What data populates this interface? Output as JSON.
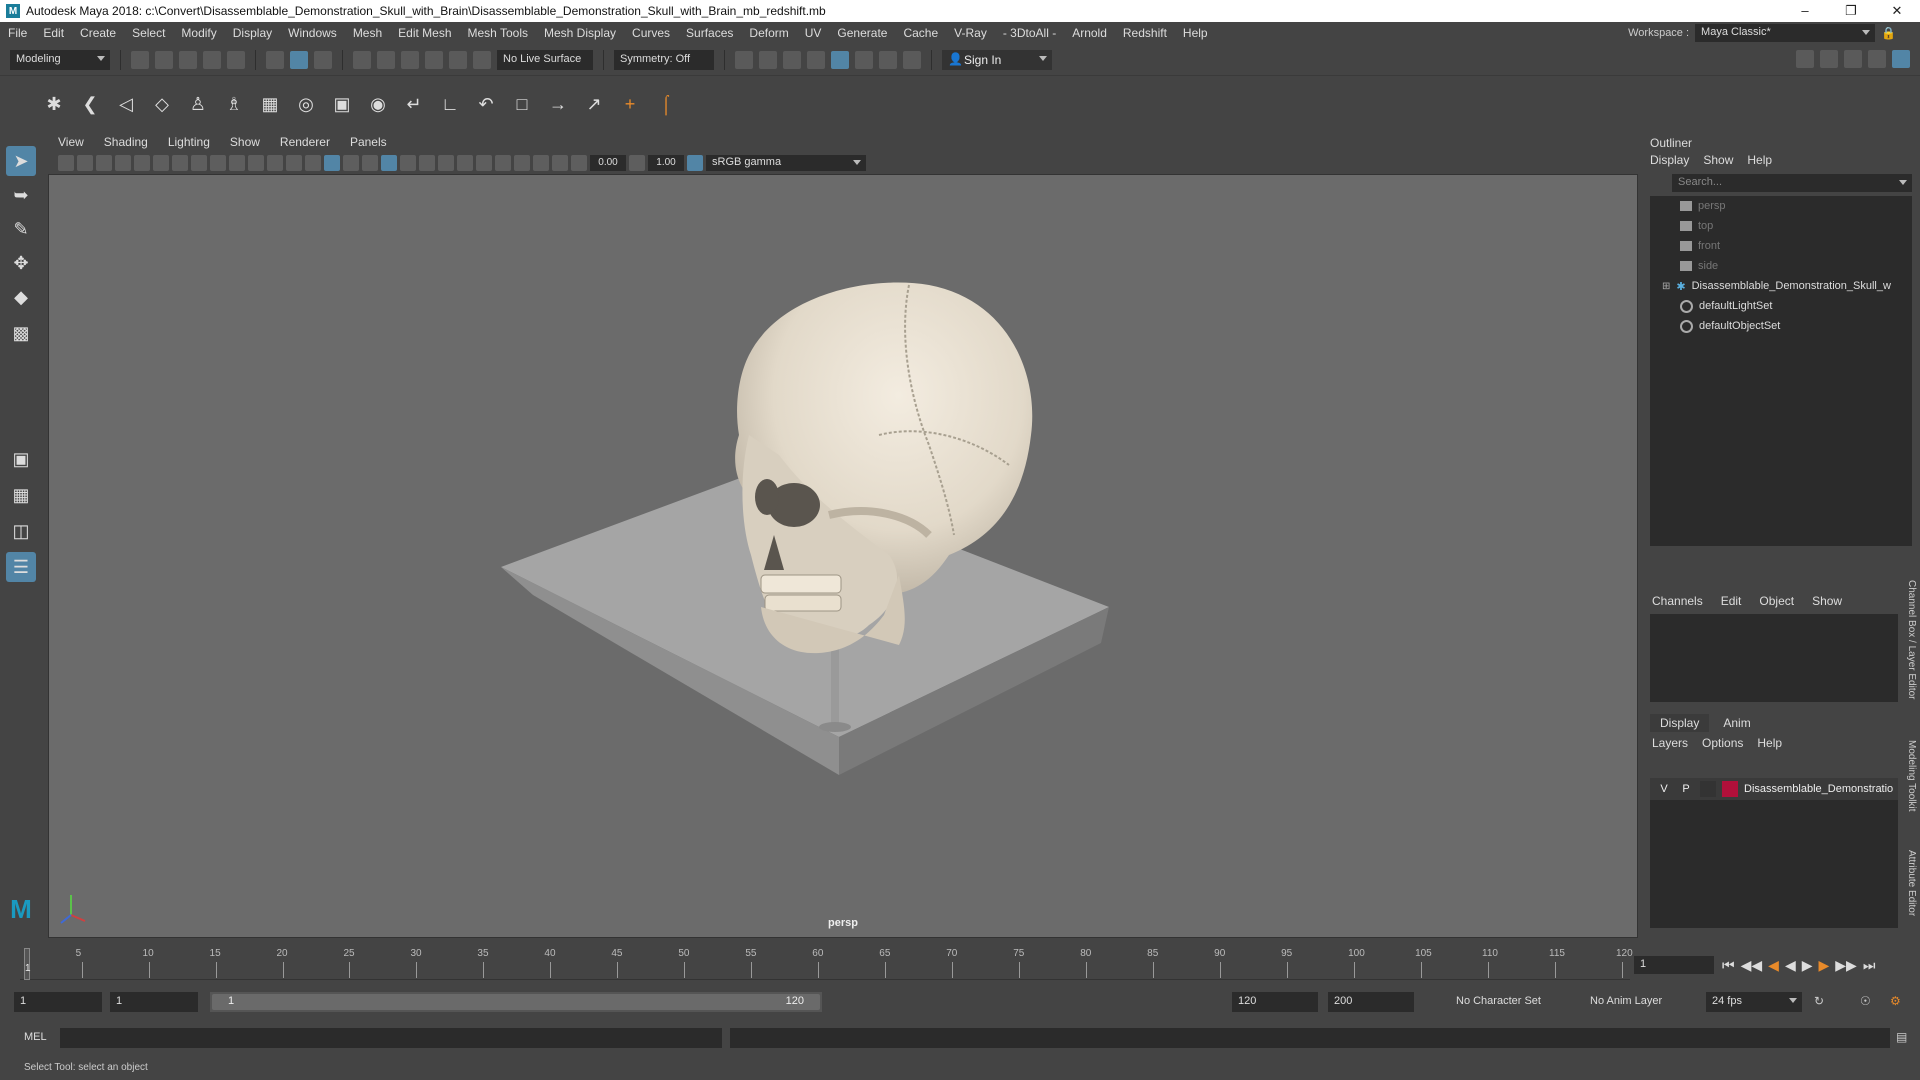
{
  "window": {
    "title": "Autodesk Maya 2018: c:\\Convert\\Disassemblable_Demonstration_Skull_with_Brain\\Disassemblable_Demonstration_Skull_with_Brain_mb_redshift.mb",
    "controls": [
      "–",
      "❐",
      "✕"
    ]
  },
  "menubar": {
    "items": [
      "File",
      "Edit",
      "Create",
      "Select",
      "Modify",
      "Display",
      "Windows",
      "Mesh",
      "Edit Mesh",
      "Mesh Tools",
      "Mesh Display",
      "Curves",
      "Surfaces",
      "Deform",
      "UV",
      "Generate",
      "Cache",
      "V-Ray",
      "- 3DtoAll -",
      "Arnold",
      "Redshift",
      "Help"
    ],
    "workspace_label": "Workspace :",
    "workspace_value": "Maya Classic*"
  },
  "statusline": {
    "menuset": "Modeling",
    "live_surface": "No Live Surface",
    "symmetry": "Symmetry: Off",
    "sign_in": "Sign In"
  },
  "viewport": {
    "menu": [
      "View",
      "Shading",
      "Lighting",
      "Show",
      "Renderer",
      "Panels"
    ],
    "exposure": "0.00",
    "gamma": "1.00",
    "color_space": "sRGB gamma",
    "camera_label": "persp"
  },
  "outliner": {
    "title": "Outliner",
    "menu": [
      "Display",
      "Show",
      "Help"
    ],
    "search_placeholder": "Search...",
    "items": [
      {
        "label": "persp",
        "type": "camera",
        "dim": true
      },
      {
        "label": "top",
        "type": "camera",
        "dim": true
      },
      {
        "label": "front",
        "type": "camera",
        "dim": true
      },
      {
        "label": "side",
        "type": "camera",
        "dim": true
      },
      {
        "label": "Disassemblable_Demonstration_Skull_w",
        "type": "group",
        "dim": false
      },
      {
        "label": "defaultLightSet",
        "type": "set",
        "dim": false
      },
      {
        "label": "defaultObjectSet",
        "type": "set",
        "dim": false
      }
    ]
  },
  "channelbox": {
    "menu": [
      "Channels",
      "Edit",
      "Object",
      "Show"
    ]
  },
  "layer_editor": {
    "tabs": [
      "Display",
      "Anim"
    ],
    "menu": [
      "Layers",
      "Options",
      "Help"
    ],
    "layer": {
      "v": "V",
      "p": "P",
      "name": "Disassemblable_Demonstratio",
      "color": "#b0103a"
    }
  },
  "side_tabs": [
    "Channel Box / Layer Editor",
    "Modeling Toolkit",
    "Attribute Editor"
  ],
  "timeslider": {
    "ticks": [
      5,
      10,
      15,
      20,
      25,
      30,
      35,
      40,
      45,
      50,
      55,
      60,
      65,
      70,
      75,
      80,
      85,
      90,
      95,
      100,
      105,
      110,
      115,
      120
    ],
    "playhead_frame": "1",
    "current_frame": "1"
  },
  "range": {
    "start": "1",
    "anim_start": "1",
    "slider_start": "1",
    "slider_end": "120",
    "anim_end": "120",
    "end": "200",
    "character_set": "No Character Set",
    "anim_layer": "No Anim Layer",
    "fps": "24 fps"
  },
  "commandline": {
    "label": "MEL"
  },
  "helpline": {
    "text": "Select Tool: select an object"
  },
  "colors": {
    "accent": "#5285a6",
    "background": "#444444",
    "viewport": "#6b6b6b"
  }
}
